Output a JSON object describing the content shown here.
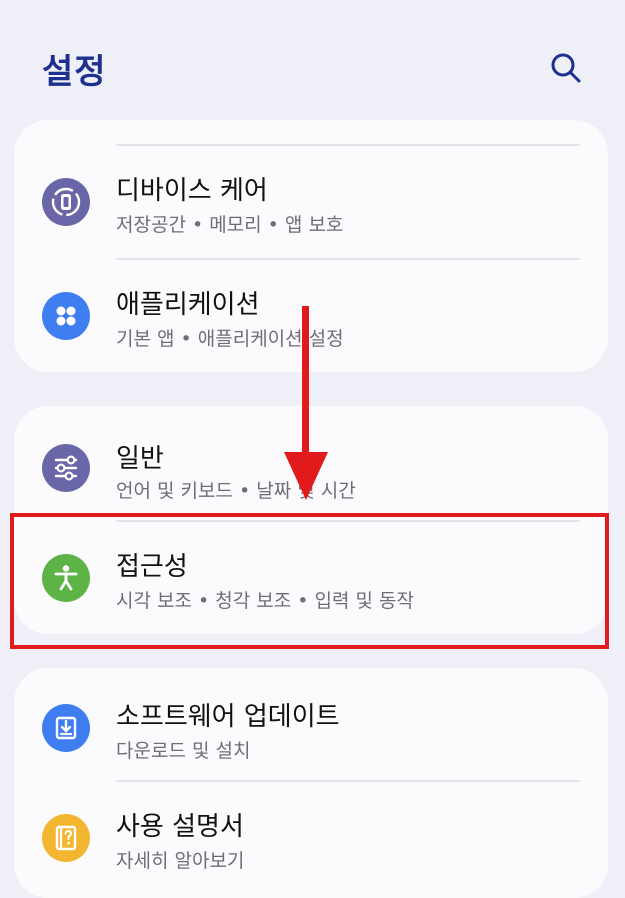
{
  "header": {
    "title": "설정",
    "search_icon": "search-icon"
  },
  "cards": [
    {
      "items": [
        {
          "title": "디바이스 케어",
          "subtitle": "저장공간 • 메모리 • 앱 보호",
          "icon": "device-care-icon",
          "color": "#6a67a8"
        },
        {
          "title": "애플리케이션",
          "subtitle": "기본 앱 • 애플리케이션 설정",
          "icon": "apps-icon",
          "color": "#3f7ef0"
        }
      ]
    },
    {
      "items": [
        {
          "title": "일반",
          "subtitle": "언어 및 키보드 • 날짜 및 시간",
          "icon": "sliders-icon",
          "color": "#6a67a8"
        },
        {
          "title": "접근성",
          "subtitle": "시각 보조 • 청각 보조 • 입력 및 동작",
          "icon": "accessibility-icon",
          "color": "#5eb347"
        }
      ]
    },
    {
      "items": [
        {
          "title": "소프트웨어 업데이트",
          "subtitle": "다운로드 및 설치",
          "icon": "software-update-icon",
          "color": "#3f7ef0"
        },
        {
          "title": "사용 설명서",
          "subtitle": "자세히 알아보기",
          "icon": "user-manual-icon",
          "color": "#f3b630"
        }
      ]
    }
  ],
  "annotation": {
    "highlight_color": "#e11b1b"
  }
}
